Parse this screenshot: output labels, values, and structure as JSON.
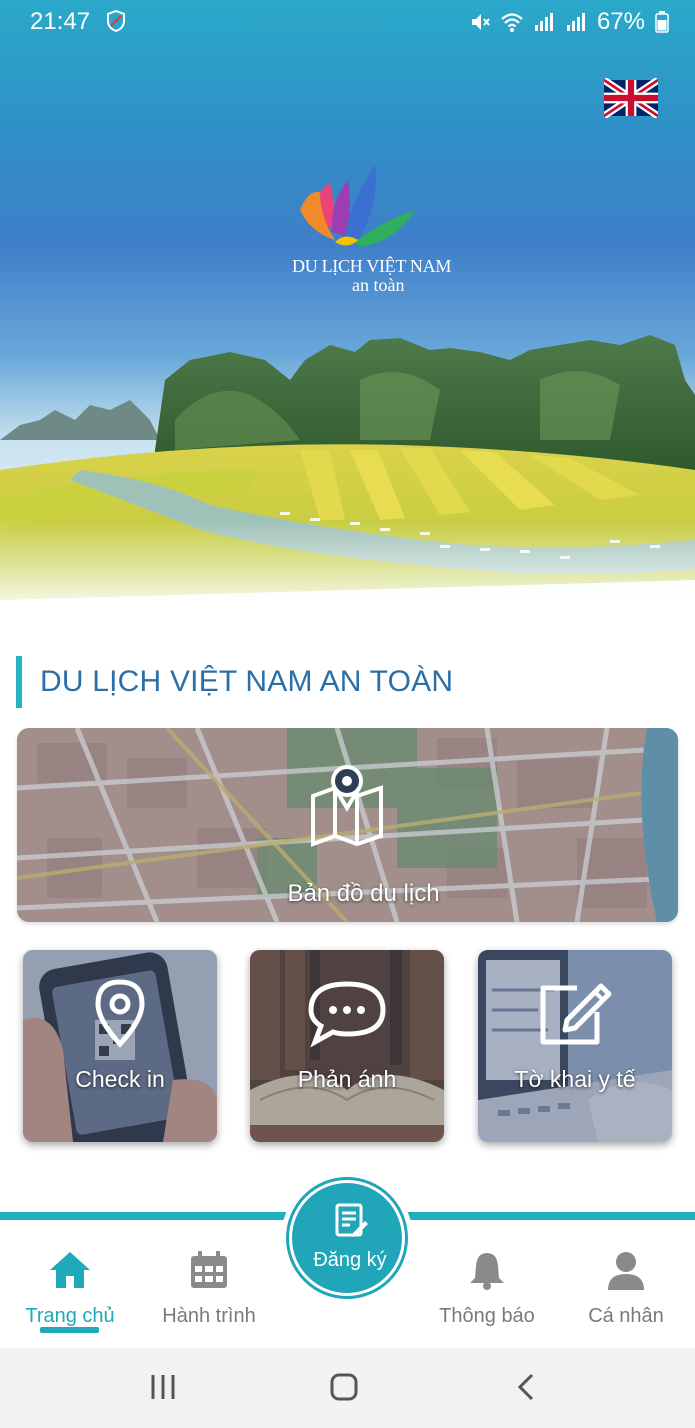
{
  "status_bar": {
    "time": "21:47",
    "battery": "67%",
    "icons": [
      "shield-icon",
      "mute-icon",
      "wifi-icon",
      "signal-icon",
      "signal-icon",
      "battery-icon"
    ]
  },
  "header": {
    "language_icon": "uk-flag-icon",
    "logo_line1": "DU LỊCH VIỆT NAM",
    "logo_line2": "an toàn"
  },
  "section": {
    "title": "DU LỊCH VIỆT NAM AN TOÀN"
  },
  "map_card": {
    "label": "Bản đồ du lịch",
    "icon": "map-pin-icon"
  },
  "tiles": [
    {
      "label": "Check in",
      "icon": "location-pin-icon"
    },
    {
      "label": "Phản ánh",
      "icon": "chat-bubble-icon"
    },
    {
      "label": "Tờ  khai y tế",
      "icon": "edit-form-icon"
    }
  ],
  "bottom_nav": {
    "items": [
      {
        "label": "Trang chủ",
        "icon": "home-icon",
        "active": true
      },
      {
        "label": "Hành trình",
        "icon": "calendar-icon",
        "active": false
      },
      {
        "label": "Thông báo",
        "icon": "bell-icon",
        "active": false
      },
      {
        "label": "Cá nhân",
        "icon": "user-icon",
        "active": false
      }
    ],
    "register": {
      "label": "Đăng ký",
      "icon": "document-edit-icon"
    }
  },
  "colors": {
    "accent": "#1fb0bd",
    "title": "#2a6fa8",
    "nav_inactive": "#7a7a7a"
  }
}
